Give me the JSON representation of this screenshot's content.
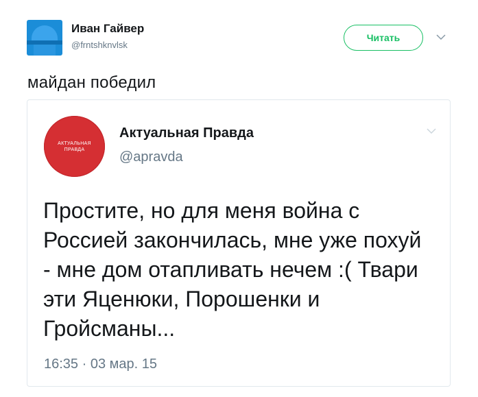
{
  "author": {
    "name": "Иван Гайвер",
    "handle": "@frntshknvlsk"
  },
  "follow_button": {
    "label": "Читать",
    "color": "#17bf63"
  },
  "tweet": {
    "text": "майдан победил"
  },
  "quoted_tweet": {
    "avatar_text_line1": "АКТУАЛЬНАЯ",
    "avatar_text_line2": "ПРАВДА",
    "avatar_color": "#d52f33",
    "author_name": "Актуальная Правда",
    "author_handle": "@apravda",
    "text": "Простите, но для меня война с Россией закончилась, мне уже похуй - мне дом отапливать нечем :( Твари эти Яценюки, Порошенки и Гройсманы...",
    "timestamp": "16:35 · 03 мар. 15"
  },
  "icons": {
    "author_avatar": "user-avatar-icon",
    "caret": "chevron-down-icon"
  }
}
